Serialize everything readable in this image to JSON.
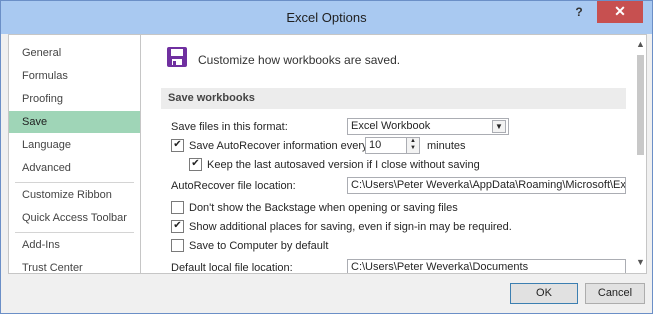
{
  "window": {
    "title": "Excel Options",
    "help_label": "?",
    "close_label": "✕"
  },
  "sidebar": {
    "items": [
      {
        "label": "General"
      },
      {
        "label": "Formulas"
      },
      {
        "label": "Proofing"
      },
      {
        "label": "Save",
        "selected": true
      },
      {
        "label": "Language"
      },
      {
        "label": "Advanced"
      },
      {
        "label": "Customize Ribbon"
      },
      {
        "label": "Quick Access Toolbar"
      },
      {
        "label": "Add-Ins"
      },
      {
        "label": "Trust Center"
      }
    ]
  },
  "main": {
    "heading": "Customize how workbooks are saved.",
    "heading_icon": "save-icon",
    "section_title": "Save workbooks",
    "format_label": "Save files in this format:",
    "format_value": "Excel Workbook",
    "autorecover_label": "Save AutoRecover information every",
    "autorecover_checked": true,
    "autorecover_minutes": "10",
    "minutes_label": "minutes",
    "keep_last_label": "Keep the last autosaved version if I close without saving",
    "keep_last_checked": true,
    "autorecover_location_label": "AutoRecover file location:",
    "autorecover_location_value": "C:\\Users\\Peter Weverka\\AppData\\Roaming\\Microsoft\\Excel\\",
    "backstage_label": "Don't show the Backstage when opening or saving files",
    "backstage_checked": false,
    "additional_places_label": "Show additional places for saving, even if sign-in may be required.",
    "additional_places_checked": true,
    "save_computer_label": "Save to Computer by default",
    "save_computer_checked": false,
    "default_location_label": "Default local file location:",
    "default_location_value": "C:\\Users\\Peter Weverka\\Documents"
  },
  "footer": {
    "ok_label": "OK",
    "cancel_label": "Cancel"
  },
  "colors": {
    "title_bar": "#a9c9f1",
    "selected_item": "#9fd5b7",
    "close_button": "#c75050",
    "save_icon": "#7030a0"
  }
}
